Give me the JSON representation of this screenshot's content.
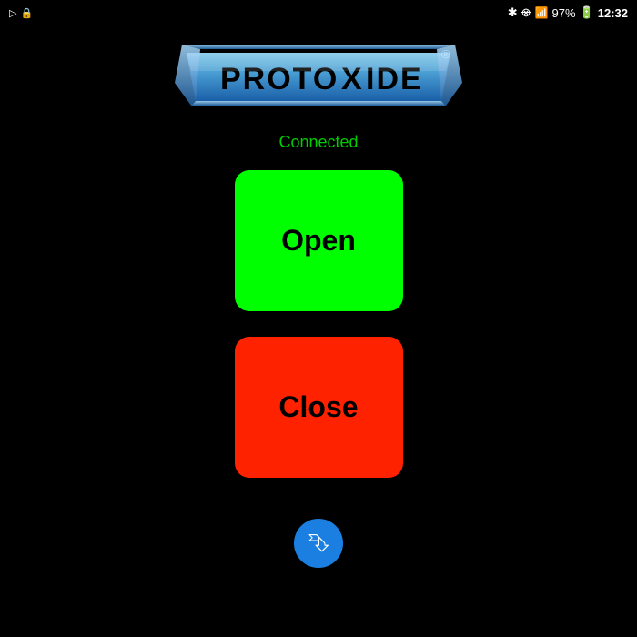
{
  "statusBar": {
    "leftIcons": [
      "▷",
      "🔒"
    ],
    "rightIcons": [
      "bluetooth-off",
      "signal",
      "battery"
    ],
    "batteryPercent": "97%",
    "time": "12:32"
  },
  "logo": {
    "text": "PROTOXIDE",
    "registeredMark": "®"
  },
  "connection": {
    "status": "Connected",
    "statusColor": "#00cc00"
  },
  "buttons": {
    "open": {
      "label": "Open",
      "bgColor": "#00ff00"
    },
    "close": {
      "label": "Close",
      "bgColor": "#ff2200"
    }
  },
  "bluetooth": {
    "iconLabel": "Bluetooth",
    "bgColor": "#1a7fe0",
    "symbol": "ᛒ"
  }
}
